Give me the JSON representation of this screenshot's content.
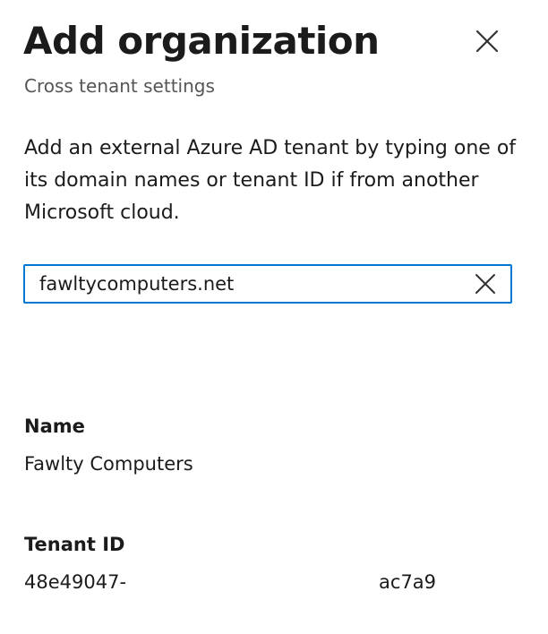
{
  "header": {
    "title": "Add organization",
    "subtitle": "Cross tenant settings"
  },
  "close_button": {
    "icon": "close-icon"
  },
  "description": "Add an external Azure AD tenant by typing one of its domain names or tenant ID if from another Microsoft cloud.",
  "search": {
    "value": "fawltycomputers.net",
    "clear_icon": "clear-icon",
    "border_color": "#0078d4"
  },
  "result": {
    "name_label": "Name",
    "name_value": "Fawlty Computers",
    "tenant_label": "Tenant ID",
    "tenant_id_start": "48e49047-",
    "tenant_id_end": "ac7a9"
  }
}
